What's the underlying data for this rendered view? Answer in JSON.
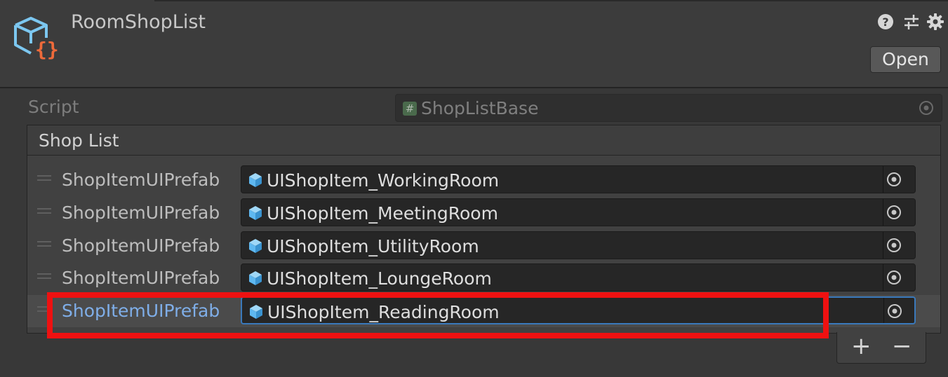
{
  "header": {
    "title": "RoomShopList",
    "asset_icon": "scriptable-object-icon",
    "icons": [
      "help-icon",
      "preset-sliders-icon",
      "gear-icon"
    ],
    "open_label": "Open"
  },
  "script_field": {
    "label": "Script",
    "value": "ShopListBase",
    "icon": "csharp-script-icon"
  },
  "shop_list": {
    "label": "Shop List",
    "items": [
      {
        "label": "ShopItemUIPrefab",
        "value": "UIShopItem_WorkingRoom"
      },
      {
        "label": "ShopItemUIPrefab",
        "value": "UIShopItem_MeetingRoom"
      },
      {
        "label": "ShopItemUIPrefab",
        "value": "UIShopItem_UtilityRoom"
      },
      {
        "label": "ShopItemUIPrefab",
        "value": "UIShopItem_LoungeRoom"
      },
      {
        "label": "ShopItemUIPrefab",
        "value": "UIShopItem_ReadingRoom"
      }
    ],
    "selected_index": 4,
    "add_label": "+",
    "remove_label": "−"
  },
  "colors": {
    "background": "#383838",
    "field_bg": "#262626",
    "selection_blue": "#7faee8",
    "focus_border": "#3a79bb",
    "highlight_red": "#ee1111",
    "prefab_icon": "#5fb8f0"
  }
}
